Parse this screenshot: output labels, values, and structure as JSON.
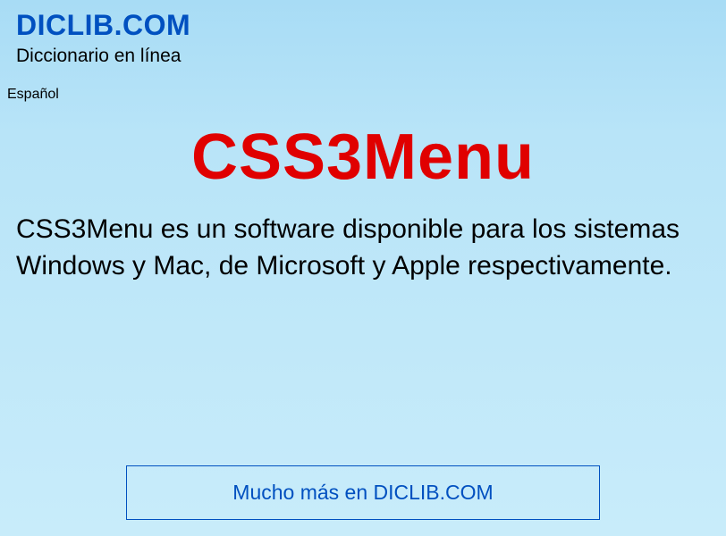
{
  "header": {
    "site_title": "DICLIB.COM",
    "site_subtitle": "Diccionario en línea",
    "language": "Español"
  },
  "article": {
    "title": "CSS3Menu",
    "body": "CSS3Menu es un software disponible para los sistemas Windows y Mac, de Microsoft y Apple respectivamente."
  },
  "cta": {
    "label": "Mucho más en DICLIB.COM"
  },
  "colors": {
    "title_blue": "#0050c0",
    "heading_red": "#e00000"
  }
}
